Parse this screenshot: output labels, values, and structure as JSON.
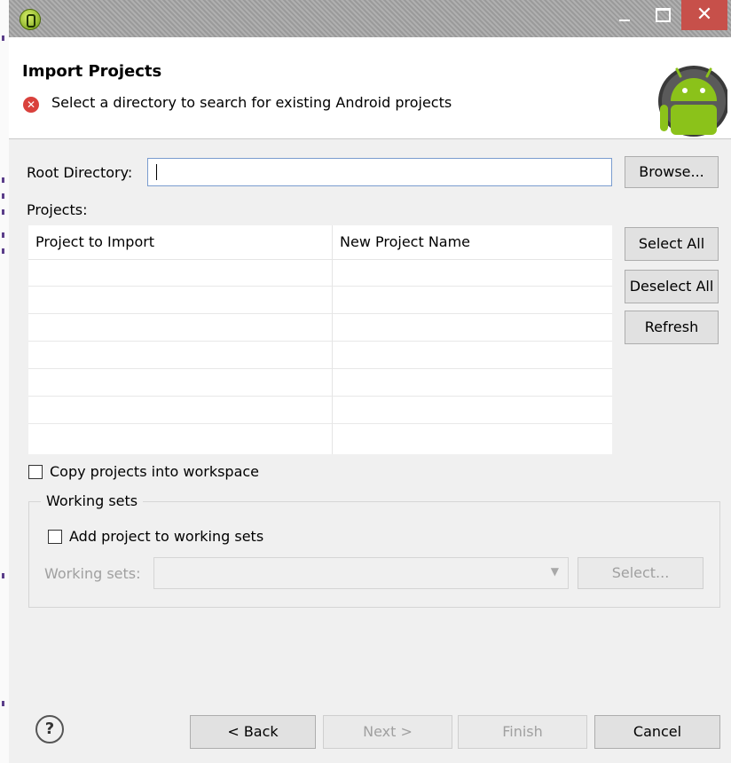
{
  "window": {
    "controls": {
      "close_glyph": "✕"
    }
  },
  "header": {
    "title": "Import Projects",
    "message": "Select a directory to search for existing Android projects",
    "error_icon_glyph": "✕"
  },
  "root_directory": {
    "label": "Root Directory:",
    "value": "",
    "browse_label": "Browse..."
  },
  "projects": {
    "label": "Projects:",
    "columns": [
      "Project to Import",
      "New Project Name"
    ],
    "rows": [],
    "select_all_label": "Select All",
    "deselect_all_label": "Deselect All",
    "refresh_label": "Refresh"
  },
  "options": {
    "copy_into_workspace_label": "Copy projects into workspace",
    "copy_into_workspace_checked": false
  },
  "working_sets": {
    "group_title": "Working sets",
    "add_to_working_sets_label": "Add project to working sets",
    "add_to_working_sets_checked": false,
    "field_label": "Working sets:",
    "field_value": "",
    "select_label": "Select..."
  },
  "footer": {
    "help_glyph": "?",
    "back_label": "< Back",
    "next_label": "Next >",
    "finish_label": "Finish",
    "cancel_label": "Cancel"
  },
  "colors": {
    "close_button": "#c7504a",
    "android_green": "#8bc21a",
    "error_red": "#d9413c",
    "input_border": "#7a9ccf"
  }
}
